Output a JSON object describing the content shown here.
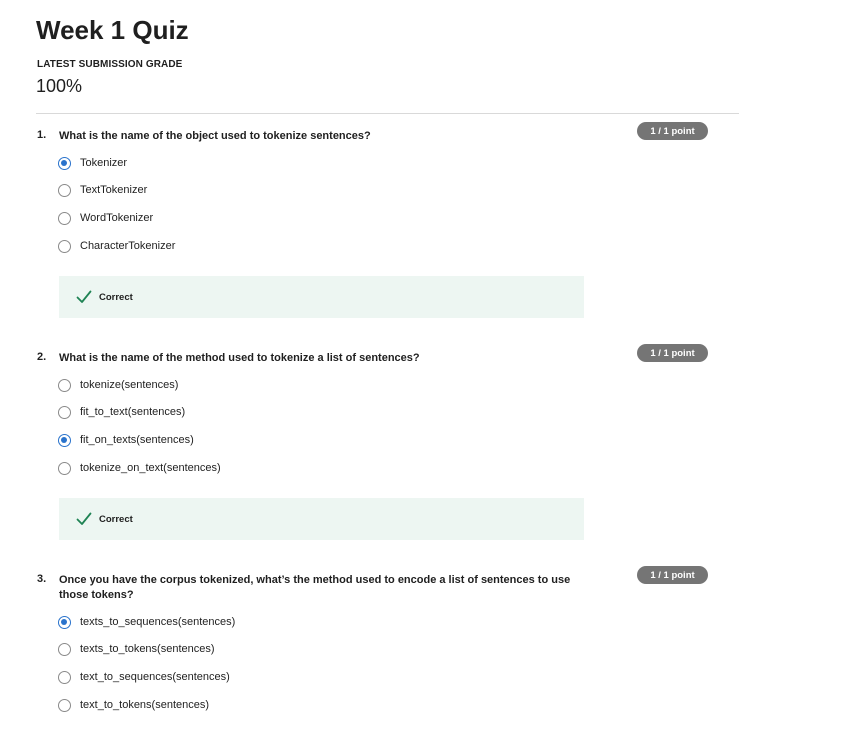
{
  "quiz": {
    "title": "Week 1 Quiz",
    "grade_label": "LATEST SUBMISSION GRADE",
    "grade_value": "100%"
  },
  "questions": [
    {
      "number": "1.",
      "text": "What is the name of the object used to tokenize sentences?",
      "points": "1 / 1 point",
      "options": [
        "Tokenizer",
        "TextTokenizer",
        "WordTokenizer",
        "CharacterTokenizer"
      ],
      "selected": 0,
      "feedback": "Correct"
    },
    {
      "number": "2.",
      "text": "What is the name of the method used to tokenize a list of sentences?",
      "points": "1 / 1 point",
      "options": [
        "tokenize(sentences)",
        "fit_to_text(sentences)",
        "fit_on_texts(sentences)",
        "tokenize_on_text(sentences)"
      ],
      "selected": 2,
      "feedback": "Correct"
    },
    {
      "number": "3.",
      "text": "Once you have the corpus tokenized, what’s the method used to encode a list of sentences to use those tokens?",
      "points": "1 / 1 point",
      "options": [
        "texts_to_sequences(sentences)",
        "texts_to_tokens(sentences)",
        "text_to_sequences(sentences)",
        "text_to_tokens(sentences)"
      ],
      "selected": 0
    }
  ],
  "colors": {
    "radio_selected": "#2a73cc",
    "pill_bg": "#757575",
    "feedback_bg": "#edf6f2",
    "check": "#1f8354"
  }
}
